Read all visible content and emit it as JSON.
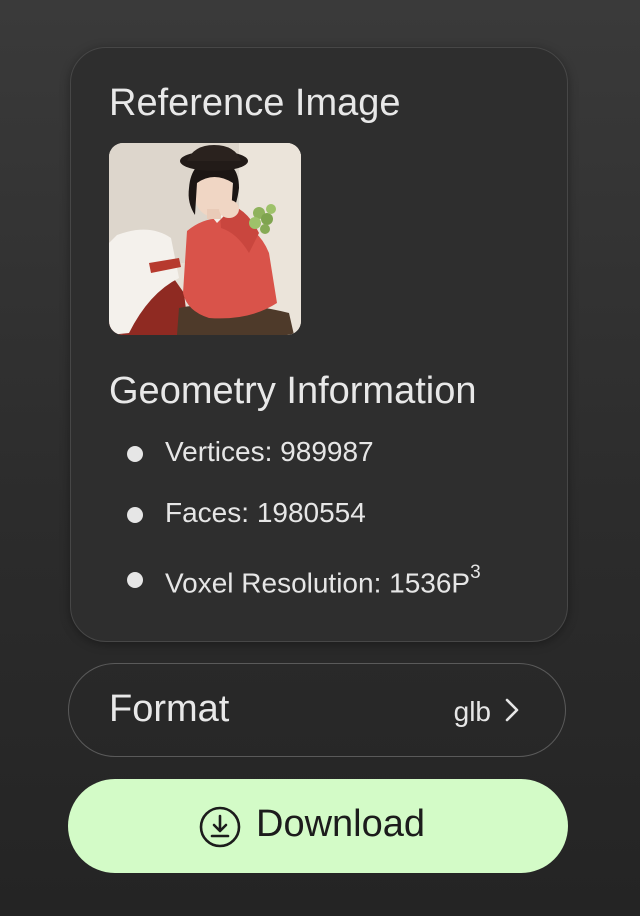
{
  "reference": {
    "title": "Reference Image"
  },
  "geometry": {
    "title": "Geometry Information",
    "vertices_label": "Vertices:",
    "vertices_value": "989987",
    "faces_label": "Faces:",
    "faces_value": "1980554",
    "voxel_label": "Voxel Resolution:",
    "voxel_value": "1536P",
    "voxel_exponent": "3"
  },
  "format": {
    "label": "Format",
    "value": "glb"
  },
  "download": {
    "label": "Download"
  },
  "colors": {
    "accent": "#d3fbc7",
    "panel": "#2e2e2e"
  }
}
